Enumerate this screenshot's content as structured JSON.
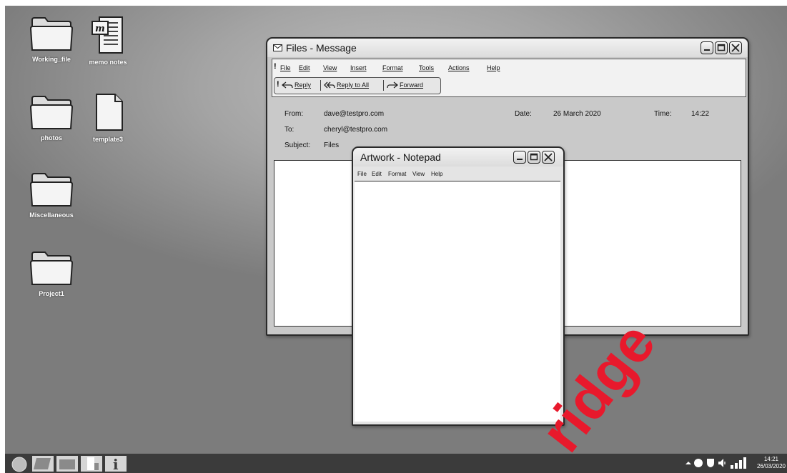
{
  "desktop_icons": [
    {
      "label": "Working_file",
      "icon": "folder-icon"
    },
    {
      "label": "memo notes",
      "icon": "document-icon"
    },
    {
      "label": "photos",
      "icon": "folder-icon"
    },
    {
      "label": "template3",
      "icon": "blank-file-icon"
    },
    {
      "label": "Miscellaneous",
      "icon": "folder-icon"
    },
    {
      "label": "Project1",
      "icon": "folder-icon"
    }
  ],
  "message_window": {
    "title": "Files - Message",
    "menu": [
      "File",
      "Edit",
      "View",
      "Insert",
      "Format",
      "Tools",
      "Actions",
      "Help"
    ],
    "toolbar": {
      "reply": "Reply",
      "reply_all": "Reply to All",
      "forward": "Forward"
    },
    "header": {
      "from_label": "From:",
      "from_value": "dave@testpro.com",
      "to_label": "To:",
      "to_value": "cheryl@testpro.com",
      "subject_label": "Subject:",
      "subject_value": "Files",
      "date_label": "Date:",
      "date_value": "26 March 2020",
      "time_label": "Time:",
      "time_value": "14:22"
    }
  },
  "notepad_window": {
    "title": "Artwork - Notepad",
    "menu": [
      "File",
      "Edit",
      "Format",
      "View",
      "Help"
    ]
  },
  "taskbar": {
    "clock_time": "14:21",
    "clock_date": "26/03/2020"
  },
  "colors": {
    "desktop": "#9e9e9e",
    "taskbar": "#3b3b3b",
    "window": "#c9c9c9",
    "watermark": "#e8192c"
  }
}
